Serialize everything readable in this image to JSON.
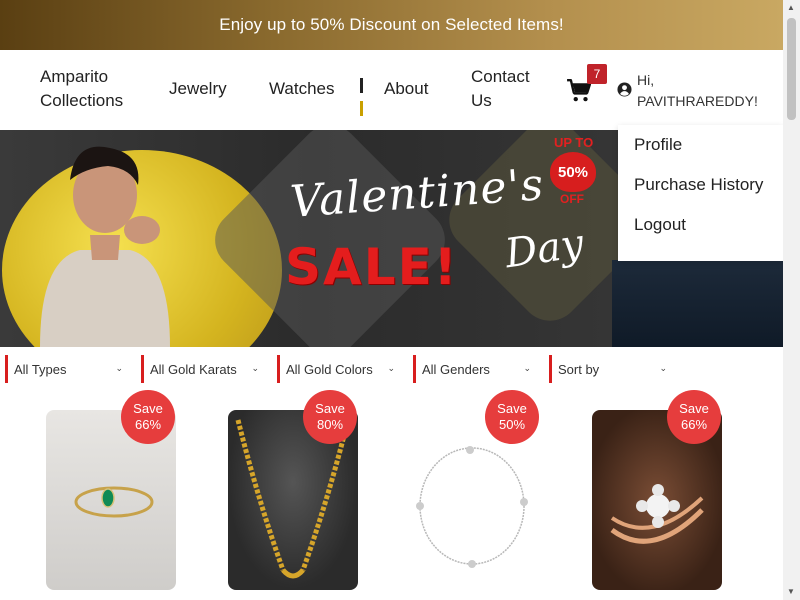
{
  "promo": {
    "text": "Enjoy up to 50% Discount on Selected Items!"
  },
  "nav": {
    "brand": "Amparito Collections",
    "links": [
      "Jewelry",
      "Watches",
      "About",
      "Contact Us"
    ],
    "cart_count": "7",
    "greeting": "Hi,",
    "username": "PAVITHRAREDDY!"
  },
  "user_menu": {
    "items": [
      "Profile",
      "Purchase History",
      "Logout"
    ]
  },
  "hero": {
    "title": "Valentine's",
    "sale": "SALE!",
    "day": "Day",
    "upto": "UP TO",
    "percent": "50%",
    "off": "OFF"
  },
  "filters": [
    "All Types",
    "All Gold Karats",
    "All Gold Colors",
    "All Genders",
    "Sort by"
  ],
  "products": [
    {
      "save_label": "Save",
      "save_pct": "66%",
      "icon": "emerald-ring-icon"
    },
    {
      "save_label": "Save",
      "save_pct": "80%",
      "icon": "gold-chain-icon"
    },
    {
      "save_label": "Save",
      "save_pct": "50%",
      "icon": "silver-bracelet-icon"
    },
    {
      "save_label": "Save",
      "save_pct": "66%",
      "icon": "rose-gold-ring-icon"
    }
  ],
  "colors": {
    "accent": "#d81e1e",
    "badge": "#e63d3d",
    "promo_start": "#5a3f12",
    "promo_end": "#c9a862"
  }
}
